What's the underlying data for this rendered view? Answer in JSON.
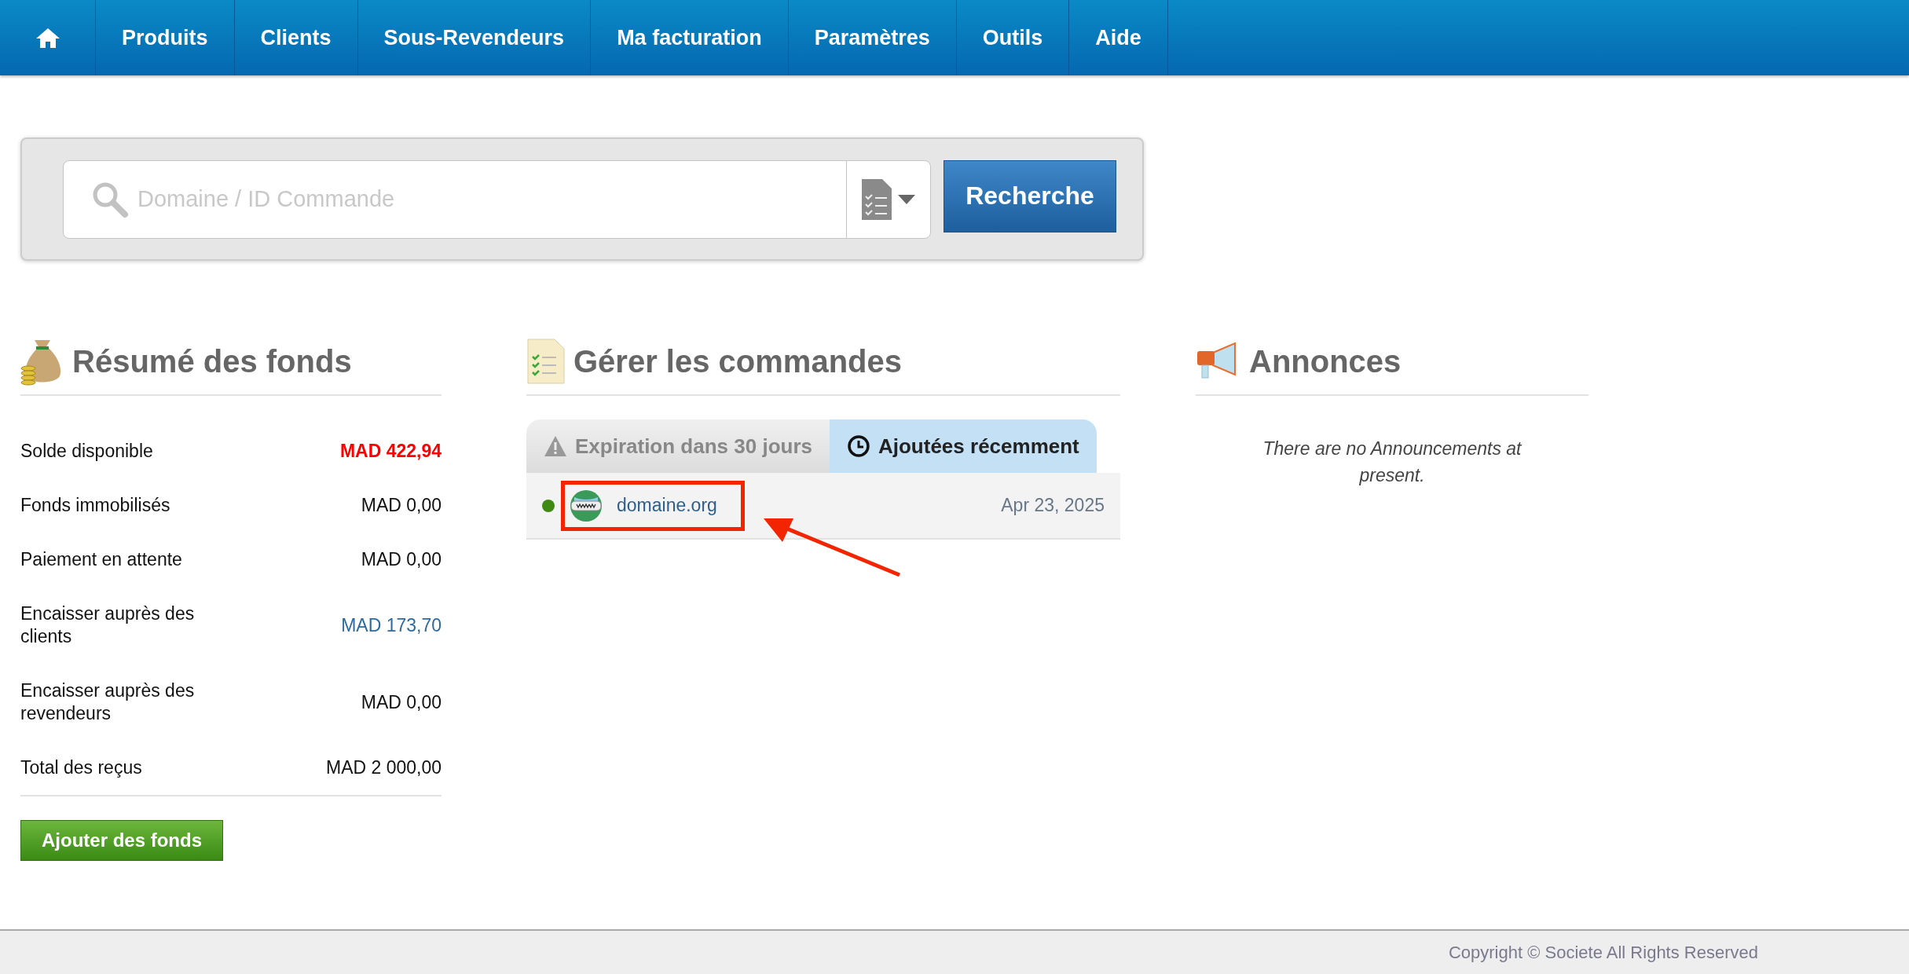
{
  "nav": {
    "items": [
      "Produits",
      "Clients",
      "Sous-Revendeurs",
      "Ma facturation",
      "Paramètres",
      "Outils",
      "Aide"
    ]
  },
  "search": {
    "placeholder": "Domaine / ID Commande",
    "button": "Recherche"
  },
  "funds": {
    "title": "Résumé des fonds",
    "rows": [
      {
        "label": "Solde disponible",
        "value": "MAD 422,94",
        "kind": "alert"
      },
      {
        "label": "Fonds immobilisés",
        "value": "MAD 0,00",
        "kind": "plain"
      },
      {
        "label": "Paiement en attente",
        "value": "MAD 0,00",
        "kind": "plain"
      },
      {
        "label": "Encaisser auprès des clients",
        "value": "MAD 173,70",
        "kind": "link"
      },
      {
        "label": "Encaisser auprès des revendeurs",
        "value": "MAD 0,00",
        "kind": "plain"
      },
      {
        "label": "Total des reçus",
        "value": "MAD 2 000,00",
        "kind": "plain"
      }
    ],
    "button": "Ajouter des fonds"
  },
  "orders": {
    "title": "Gérer les commandes",
    "tabs": [
      {
        "label": "Expiration dans 30 jours",
        "kind": "warning",
        "selected": false
      },
      {
        "label": "Ajoutées récemment",
        "kind": "clock",
        "selected": true
      }
    ],
    "rows": [
      {
        "name": "domaine.org",
        "date": "Apr 23, 2025",
        "color": "#3e8a12",
        "annotated": true
      }
    ]
  },
  "announcements": {
    "title": "Annonces",
    "message": "There are no Announcements at present."
  },
  "footer": {
    "copyright": "Copyright © Societe All Rights Reserved"
  }
}
